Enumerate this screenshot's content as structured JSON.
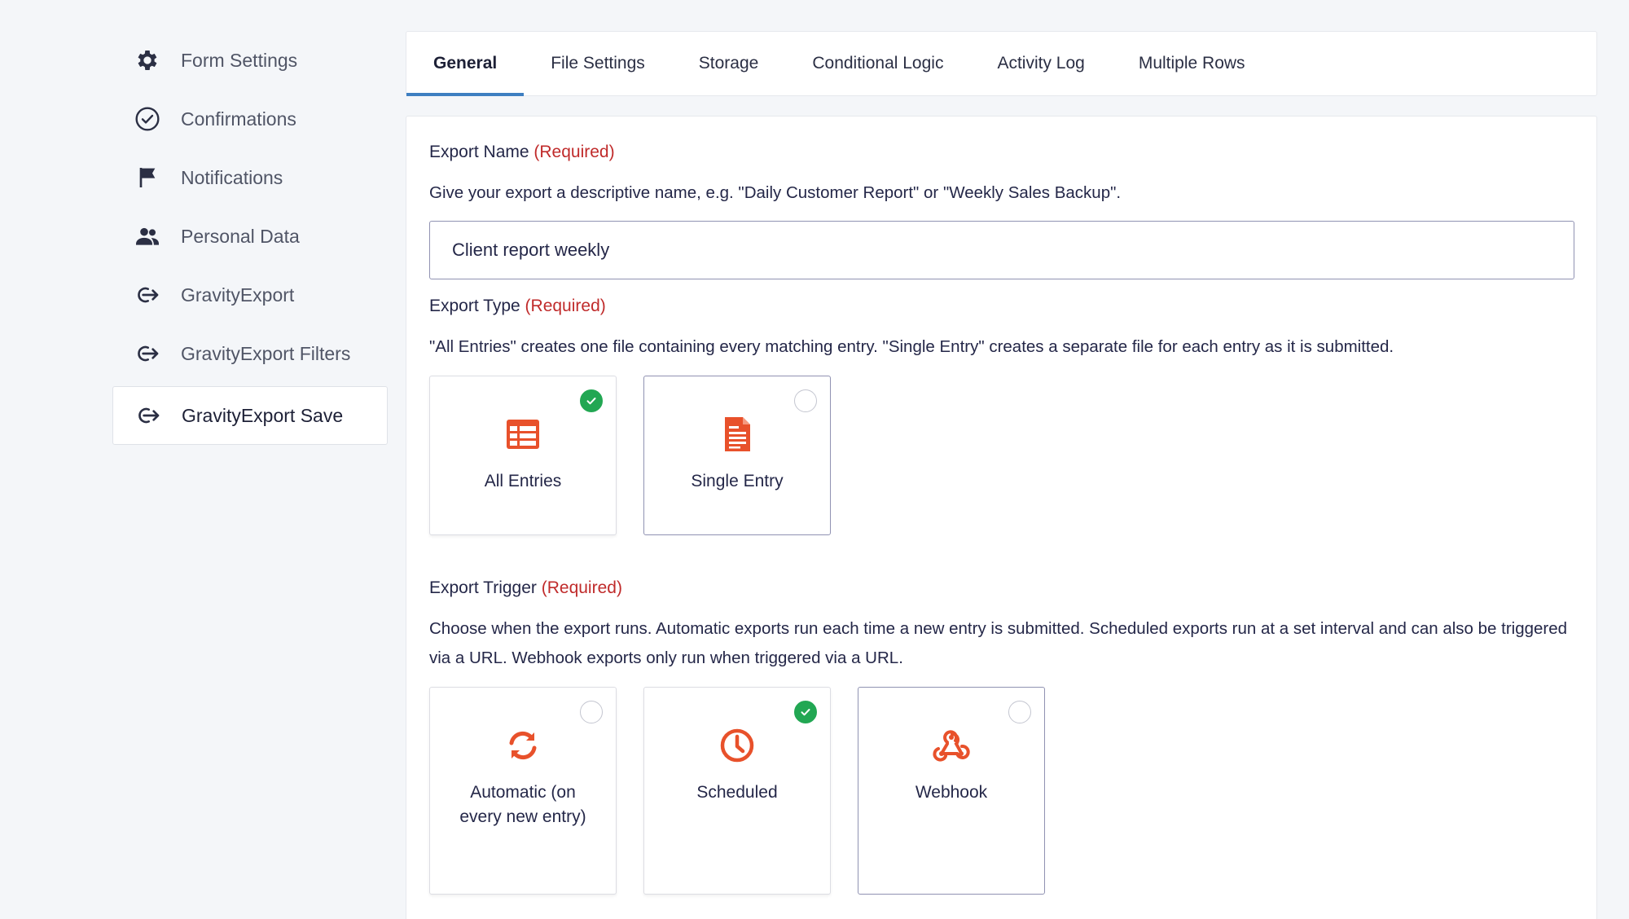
{
  "sidebar": {
    "items": [
      {
        "label": "Form Settings",
        "icon": "gear-icon"
      },
      {
        "label": "Confirmations",
        "icon": "check-circle-icon"
      },
      {
        "label": "Notifications",
        "icon": "flag-icon"
      },
      {
        "label": "Personal Data",
        "icon": "users-icon"
      },
      {
        "label": "GravityExport",
        "icon": "export-arrow-icon"
      },
      {
        "label": "GravityExport Filters",
        "icon": "export-arrow-icon"
      },
      {
        "label": "GravityExport Save",
        "icon": "export-arrow-icon",
        "active": true
      }
    ]
  },
  "tabs": [
    {
      "label": "General",
      "active": true
    },
    {
      "label": "File Settings"
    },
    {
      "label": "Storage"
    },
    {
      "label": "Conditional Logic"
    },
    {
      "label": "Activity Log"
    },
    {
      "label": "Multiple Rows"
    }
  ],
  "export_name": {
    "label": "Export Name",
    "required": "(Required)",
    "description": "Give your export a descriptive name, e.g. \"Daily Customer Report\" or \"Weekly Sales Backup\".",
    "value": "Client report weekly"
  },
  "export_type": {
    "label": "Export Type",
    "required": "(Required)",
    "description": "\"All Entries\" creates one file containing every matching entry. \"Single Entry\" creates a separate file for each entry as it is submitted.",
    "options": [
      {
        "label": "All Entries",
        "icon": "table-icon",
        "selected": true
      },
      {
        "label": "Single Entry",
        "icon": "document-icon",
        "selected": false
      }
    ]
  },
  "export_trigger": {
    "label": "Export Trigger",
    "required": "(Required)",
    "description": "Choose when the export runs. Automatic exports run each time a new entry is submitted. Scheduled exports run at a set interval and can also be triggered via a URL. Webhook exports only run when triggered via a URL.",
    "options": [
      {
        "label": "Automatic (on every new entry)",
        "icon": "sync-icon",
        "selected": false
      },
      {
        "label": "Scheduled",
        "icon": "clock-icon",
        "selected": true
      },
      {
        "label": "Webhook",
        "icon": "webhook-icon",
        "selected": false
      }
    ]
  },
  "colors": {
    "accent": "#3e7fc1",
    "required": "#c02b2b",
    "icon_orange": "#e8512b",
    "check_green": "#22a753"
  }
}
